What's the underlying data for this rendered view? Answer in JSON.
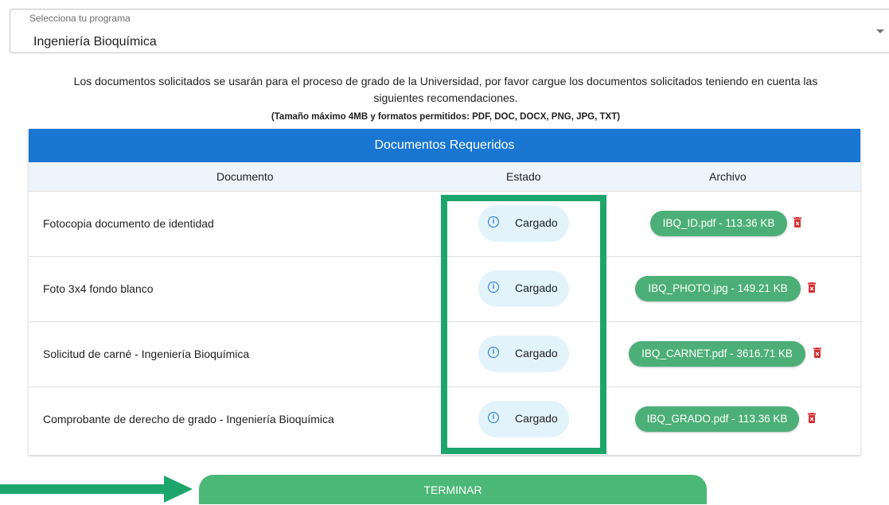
{
  "program_select": {
    "label": "Selecciona tu programa",
    "value": "Ingeniería Bioquímica"
  },
  "instructions": {
    "line1": "Los documentos solicitados se usarán para el proceso de grado de la Universidad, por favor cargue los documentos solicitados teniendo en cuenta las",
    "line2": "siguientes recomendaciones.",
    "limits": "(Tamaño máximo 4MB y formatos permitidos: PDF, DOC, DOCX, PNG, JPG, TXT)"
  },
  "table": {
    "title": "Documentos Requeridos",
    "columns": [
      "Documento",
      "Estado",
      "Archivo"
    ],
    "rows": [
      {
        "document": "Fotocopia documento de identidad",
        "status": "Cargado",
        "file": "IBQ_ID.pdf - 113.36 KB"
      },
      {
        "document": "Foto 3x4 fondo blanco",
        "status": "Cargado",
        "file": "IBQ_PHOTO.jpg - 149.21 KB"
      },
      {
        "document": "Solicitud de carné - Ingeniería Bioquímica",
        "status": "Cargado",
        "file": "IBQ_CARNET.pdf - 3616.71 KB"
      },
      {
        "document": "Comprobante de derecho de grado - Ingeniería Bioquímica",
        "status": "Cargado",
        "file": "IBQ_GRADO.pdf - 113.36 KB"
      }
    ]
  },
  "icons": {
    "status": "info-circle-icon",
    "delete": "trash-icon",
    "select": "caret-down-icon",
    "pointer": "arrow-right-icon"
  },
  "colors": {
    "header": "#1976d2",
    "chip": "#4caf77",
    "highlight": "#1da66b",
    "delete": "#d32f2f",
    "button": "#4cb877"
  },
  "finish_button": {
    "label": "TERMINAR"
  }
}
